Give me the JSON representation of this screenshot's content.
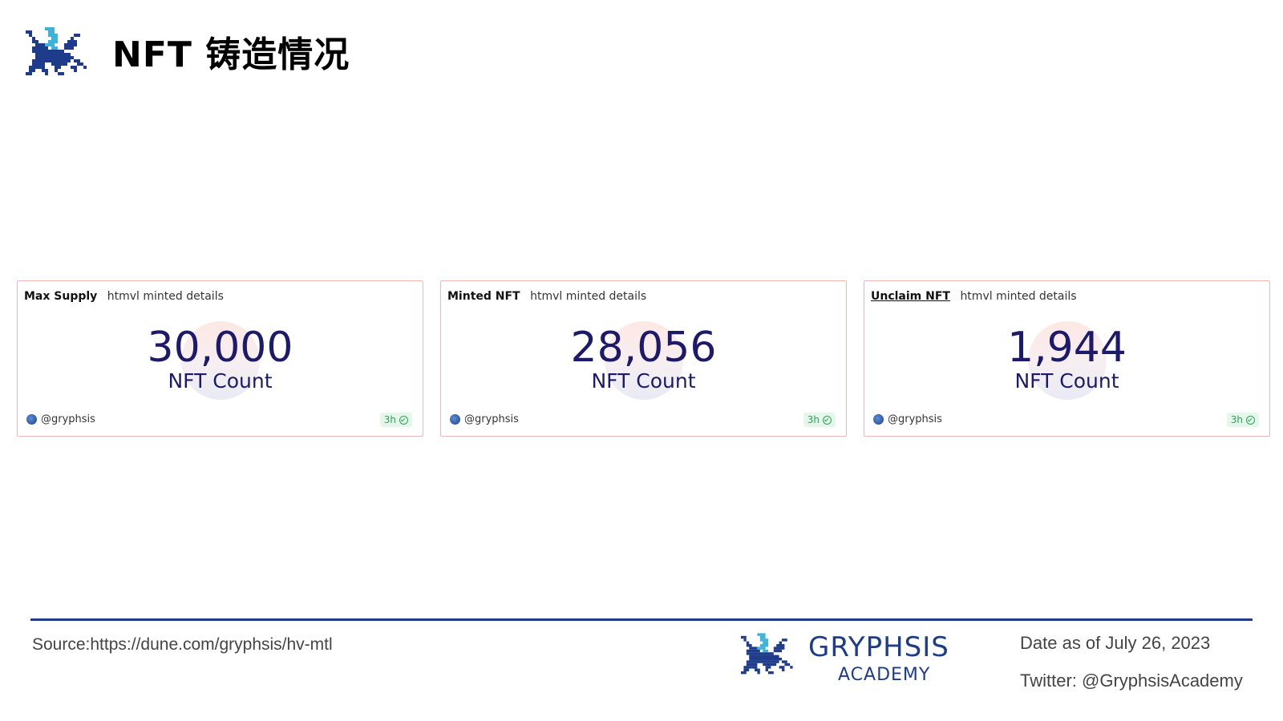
{
  "header": {
    "title": "NFT 铸造情况",
    "logo_icon": "gryphon-pixel-logo-icon"
  },
  "cards": [
    {
      "name": "Max Supply",
      "query": "htmvl minted details",
      "value": "30,000",
      "label": "NFT Count",
      "author": "@gryphsis",
      "age": "3h",
      "name_underlined": false
    },
    {
      "name": "Minted NFT",
      "query": "htmvl minted details",
      "value": "28,056",
      "label": "NFT Count",
      "author": "@gryphsis",
      "age": "3h",
      "name_underlined": false
    },
    {
      "name": "Unclaim NFT",
      "query": "htmvl minted details",
      "value": "1,944",
      "label": "NFT Count",
      "author": "@gryphsis",
      "age": "3h",
      "name_underlined": true
    }
  ],
  "footer": {
    "source": "Source:https://dune.com/gryphsis/hv-mtl",
    "brand_name": "GRYPHSIS",
    "brand_sub": "ACADEMY",
    "date": "Date as of July 26, 2023",
    "twitter": "Twitter: @GryphsisAcademy"
  },
  "colors": {
    "accent": "#1f3c8a",
    "value_text": "#1d1a6b",
    "card_border": "#f0b8b2",
    "fresh_badge": "#2aa55a"
  }
}
